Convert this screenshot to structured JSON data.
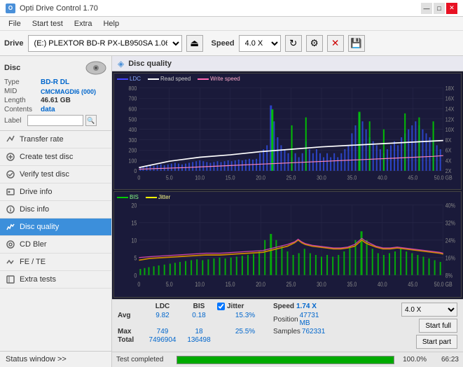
{
  "app": {
    "title": "Opti Drive Control 1.70",
    "icon": "O"
  },
  "titlebar": {
    "minimize": "—",
    "maximize": "□",
    "close": "✕"
  },
  "menu": {
    "items": [
      "File",
      "Start test",
      "Extra",
      "Help"
    ]
  },
  "toolbar": {
    "drive_label": "Drive",
    "drive_value": "(E:) PLEXTOR BD-R  PX-LB950SA 1.06",
    "speed_label": "Speed",
    "speed_value": "4.0 X"
  },
  "disc": {
    "title": "Disc",
    "type_label": "Type",
    "type_value": "BD-R DL",
    "mid_label": "MID",
    "mid_value": "CMCMAGDI6 (000)",
    "length_label": "Length",
    "length_value": "46.61 GB",
    "contents_label": "Contents",
    "contents_value": "data",
    "label_label": "Label",
    "label_value": ""
  },
  "nav": {
    "items": [
      {
        "id": "transfer-rate",
        "label": "Transfer rate",
        "active": false
      },
      {
        "id": "create-test-disc",
        "label": "Create test disc",
        "active": false
      },
      {
        "id": "verify-test-disc",
        "label": "Verify test disc",
        "active": false
      },
      {
        "id": "drive-info",
        "label": "Drive info",
        "active": false
      },
      {
        "id": "disc-info",
        "label": "Disc info",
        "active": false
      },
      {
        "id": "disc-quality",
        "label": "Disc quality",
        "active": true
      },
      {
        "id": "cd-bler",
        "label": "CD Bler",
        "active": false
      },
      {
        "id": "fe-te",
        "label": "FE / TE",
        "active": false
      },
      {
        "id": "extra-tests",
        "label": "Extra tests",
        "active": false
      }
    ],
    "status_window": "Status window >>"
  },
  "chart": {
    "title": "Disc quality",
    "legend_top": [
      {
        "label": "LDC",
        "color": "#4444ff"
      },
      {
        "label": "Read speed",
        "color": "#ffffff"
      },
      {
        "label": "Write speed",
        "color": "#ff69b4"
      }
    ],
    "legend_bottom": [
      {
        "label": "BIS",
        "color": "#00ff00"
      },
      {
        "label": "Jitter",
        "color": "#ffff00"
      }
    ],
    "top_y_left": [
      "800",
      "700",
      "600",
      "500",
      "400",
      "300",
      "200",
      "100",
      "0"
    ],
    "top_y_right": [
      "18X",
      "16X",
      "14X",
      "12X",
      "10X",
      "8X",
      "6X",
      "4X",
      "2X"
    ],
    "bottom_y_left": [
      "20",
      "15",
      "10",
      "5",
      "0"
    ],
    "bottom_y_right": [
      "40%",
      "32%",
      "24%",
      "16%",
      "8%"
    ],
    "x_labels": [
      "0",
      "5.0",
      "10.0",
      "15.0",
      "20.0",
      "25.0",
      "30.0",
      "35.0",
      "40.0",
      "45.0",
      "50.0 GB"
    ]
  },
  "stats": {
    "headers": [
      "",
      "LDC",
      "BIS",
      "",
      "Jitter",
      "Speed",
      ""
    ],
    "avg_label": "Avg",
    "avg_ldc": "9.82",
    "avg_bis": "0.18",
    "avg_jitter": "15.3%",
    "avg_speed_label": "Speed",
    "avg_speed_value": "1.74 X",
    "max_label": "Max",
    "max_ldc": "749",
    "max_bis": "18",
    "max_jitter": "25.5%",
    "position_label": "Position",
    "position_value": "47731 MB",
    "total_label": "Total",
    "total_ldc": "7496904",
    "total_bis": "136498",
    "samples_label": "Samples",
    "samples_value": "762331",
    "speed_select": "4.0 X",
    "start_full": "Start full",
    "start_part": "Start part",
    "jitter_checked": true,
    "jitter_label": "Jitter"
  },
  "progress": {
    "status_label": "Test completed",
    "percent": "100.0%",
    "time": "66:23"
  }
}
